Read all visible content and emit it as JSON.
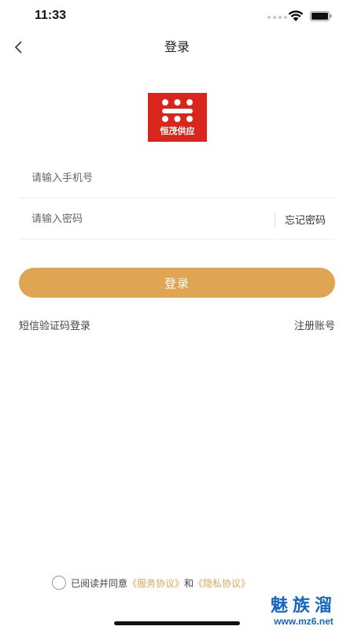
{
  "status_bar": {
    "time": "11:33",
    "wifi_icon": "wifi-icon",
    "battery_icon": "battery-icon"
  },
  "nav": {
    "back_icon": "chevron-left-icon",
    "title": "登录"
  },
  "logo": {
    "text": "恒茂供应",
    "brand_color": "#d9261c"
  },
  "form": {
    "phone_placeholder": "请输入手机号",
    "phone_value": "",
    "password_placeholder": "请输入密码",
    "password_value": "",
    "forgot_password": "忘记密码",
    "login_button": "登录",
    "sms_login": "短信验证码登录",
    "register": "注册账号"
  },
  "agreement": {
    "checked": false,
    "prefix": "已阅读并同意",
    "service": "《服务协议》",
    "and": "和",
    "privacy": "《隐私协议》"
  },
  "watermark": {
    "name": "魅族溜",
    "url": "www.mz6.net"
  },
  "colors": {
    "accent": "#dfa553",
    "watermark": "#1666c4",
    "divider": "#eeeeee"
  }
}
